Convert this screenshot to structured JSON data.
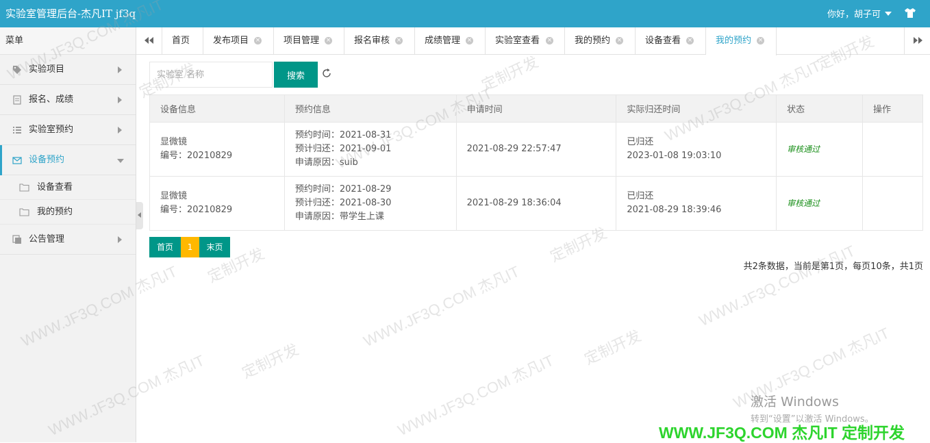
{
  "header": {
    "title": "实验室管理后台-杰凡IT jf3q",
    "user_greeting": "你好，胡子可"
  },
  "sidebar": {
    "menu_title": "菜单",
    "items": [
      {
        "label": "实验项目",
        "icon": "tag-icon"
      },
      {
        "label": "报名、成绩",
        "icon": "document-icon"
      },
      {
        "label": "实验室预约",
        "icon": "list-icon"
      },
      {
        "label": "设备预约",
        "icon": "envelope-icon",
        "active": true
      },
      {
        "label": "公告管理",
        "icon": "copy-icon"
      }
    ],
    "subitems": [
      {
        "label": "设备查看",
        "icon": "folder-icon"
      },
      {
        "label": "我的预约",
        "icon": "folder-icon"
      }
    ]
  },
  "tabs": [
    {
      "label": "首页"
    },
    {
      "label": "发布项目"
    },
    {
      "label": "项目管理"
    },
    {
      "label": "报名审核"
    },
    {
      "label": "成绩管理"
    },
    {
      "label": "实验室查看"
    },
    {
      "label": "我的预约"
    },
    {
      "label": "设备查看"
    },
    {
      "label": "我的预约",
      "active": true
    }
  ],
  "search": {
    "placeholder": "实验室 名称",
    "button_label": "搜索"
  },
  "table": {
    "headers": [
      "设备信息",
      "预约信息",
      "申请时间",
      "实际归还时间",
      "状态",
      "操作"
    ],
    "rows": [
      {
        "device_name": "显微镜",
        "device_no": "编号：20210829",
        "reserve_time": "预约时间：2021-08-31",
        "plan_return": "预计归还：2021-09-01",
        "reason": "申请原因：suib",
        "apply_time": "2021-08-29 22:57:47",
        "return_status": "已归还",
        "return_time": "2023-01-08 19:03:10",
        "status": "审核通过",
        "action": ""
      },
      {
        "device_name": "显微镜",
        "device_no": "编号：20210829",
        "reserve_time": "预约时间：2021-08-29",
        "plan_return": "预计归还：2021-08-30",
        "reason": "申请原因：带学生上课",
        "apply_time": "2021-08-29 18:36:04",
        "return_status": "已归还",
        "return_time": "2021-08-29 18:39:46",
        "status": "审核通过",
        "action": ""
      }
    ]
  },
  "pager": {
    "first": "首页",
    "current": "1",
    "last": "末页",
    "info": "共2条数据，当前是第1页，每页10条，共1页"
  },
  "overlay": {
    "windows_line1": "激活 Windows",
    "windows_line2": "转到“设置”以激活 Windows。",
    "brand": "WWW.JF3Q.COM 杰凡IT  定制开发",
    "watermark_a": "WWW.JF3Q.COM 杰凡IT",
    "watermark_b": "定制开发"
  },
  "colors": {
    "header": "#2fa4c9",
    "primary_button": "#009688",
    "pager_current": "#ffb800",
    "status_ok": "#1a8f1a",
    "brand": "#2dd42d"
  }
}
